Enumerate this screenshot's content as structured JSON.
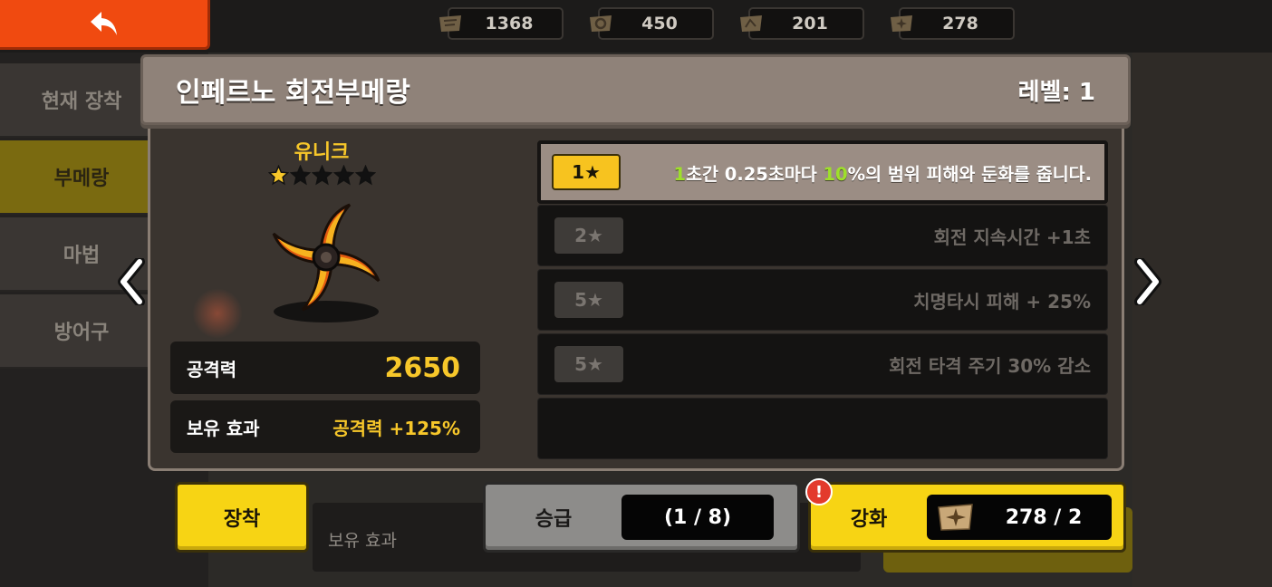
{
  "resources": [
    {
      "icon": "scroll-icon",
      "value": "1368"
    },
    {
      "icon": "ring-icon",
      "value": "450"
    },
    {
      "icon": "map-icon",
      "value": "201"
    },
    {
      "icon": "boomerang-scroll-icon",
      "value": "278"
    }
  ],
  "side_tabs": [
    "현재 장착",
    "부메랑",
    "마법",
    "방어구"
  ],
  "item": {
    "title": "인페르노 회전부메랑",
    "level_label": "레벨: 1",
    "rarity": "유니크",
    "star_count": 1,
    "star_max": 5
  },
  "stats": {
    "attack_label": "공격력",
    "attack_value": "2650",
    "hold_label": "보유 효과",
    "hold_value": "공격력 +125%"
  },
  "abilities": [
    {
      "badge": "1★",
      "parts": [
        "1",
        "초간 0.25초마다 ",
        "10",
        "%의 범위 피해와 둔화를 줍니다."
      ],
      "active": true
    },
    {
      "badge": "2★",
      "text": "회전 지속시간 +1초",
      "active": false
    },
    {
      "badge": "5★",
      "text": "치명타시 피해 + 25%",
      "active": false
    },
    {
      "badge": "5★",
      "text": "회전 타격 주기 30% 감소",
      "active": false
    }
  ],
  "buttons": {
    "equip": "장착",
    "promote": "승급",
    "promote_progress": "(1 / 8)",
    "enhance": "강화",
    "enhance_cost": "278 / 2",
    "alert": "!"
  },
  "background": {
    "hold_label": "보유 효과"
  },
  "colors": {
    "accent_yellow": "#f7d414",
    "rarity_gold": "#f7c72a",
    "highlight_green": "#9ee02a",
    "back_orange": "#f04a10"
  }
}
